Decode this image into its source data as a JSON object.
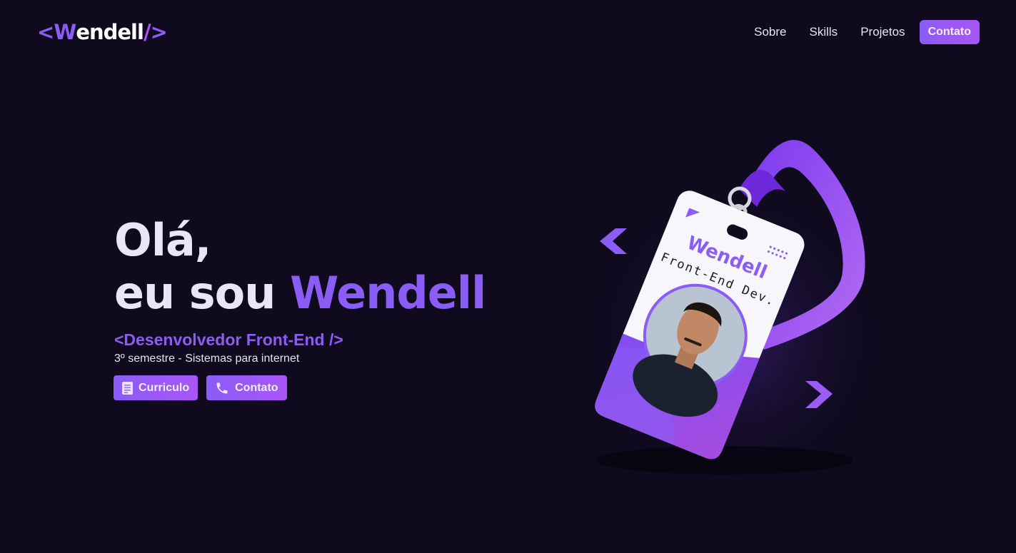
{
  "logo": {
    "open": "<",
    "w": "W",
    "rest": "endell",
    "slash": "/",
    "close": ">"
  },
  "nav": {
    "links": [
      "Sobre",
      "Skills",
      "Projetos"
    ],
    "cta": "Contato"
  },
  "hero": {
    "line1": "Olá,",
    "line2_prefix": "eu sou ",
    "name": "Wendell",
    "role": "<Desenvolvedor Front-End />",
    "subtitle": "3º semestre - Sistemas para internet",
    "buttons": {
      "resume": {
        "label": "Curriculo",
        "icon": "document-icon"
      },
      "contact": {
        "label": "Contato",
        "icon": "phone-icon"
      }
    }
  },
  "badge": {
    "name": "Wendell",
    "title": "Front-End Dev."
  },
  "colors": {
    "background": "#0f0a1e",
    "accent": "#8b5cf6",
    "accent_light": "#a855f7",
    "text": "#ebe6f7"
  }
}
